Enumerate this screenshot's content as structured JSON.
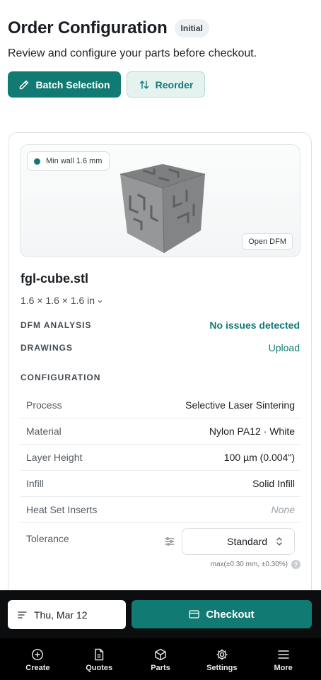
{
  "header": {
    "title": "Order Configuration",
    "badge": "Initial",
    "subtitle": "Review and configure your parts before checkout.",
    "batch_label": "Batch Selection",
    "reorder_label": "Reorder"
  },
  "part": {
    "min_wall_chip": "Min wall 1.6 mm",
    "open_dfm_label": "Open DFM",
    "filename": "fgl-cube.stl",
    "dimensions": "1.6 × 1.6 × 1.6 in",
    "dfm_label": "DFM ANALYSIS",
    "dfm_value": "No issues detected",
    "drawings_label": "DRAWINGS",
    "drawings_value": "Upload"
  },
  "configuration": {
    "title": "CONFIGURATION",
    "rows": [
      {
        "label": "Process",
        "value": "Selective Laser Sintering"
      },
      {
        "label": "Material",
        "value": "Nylon PA12 · White"
      },
      {
        "label": "Layer Height",
        "value": "100 µm (0.004\")"
      },
      {
        "label": "Infill",
        "value": "Solid Infill"
      },
      {
        "label": "Heat Set Inserts",
        "value": "None"
      }
    ],
    "tolerance_label": "Tolerance",
    "tolerance_value": "Standard",
    "tolerance_note": "max(±0.30 mm, ±0.30%)",
    "help_glyph": "?"
  },
  "footer": {
    "date_label": "Thu, Mar 12",
    "checkout_label": "Checkout"
  },
  "tabs": [
    {
      "label": "Create",
      "icon": "plus-circle-icon"
    },
    {
      "label": "Quotes",
      "icon": "document-icon"
    },
    {
      "label": "Parts",
      "icon": "cube-icon"
    },
    {
      "label": "Settings",
      "icon": "gear-icon"
    },
    {
      "label": "More",
      "icon": "menu-icon"
    }
  ],
  "colors": {
    "accent": "#117a72",
    "accent_light": "#e6f2f0",
    "bar_background": "#0c0d0e"
  }
}
